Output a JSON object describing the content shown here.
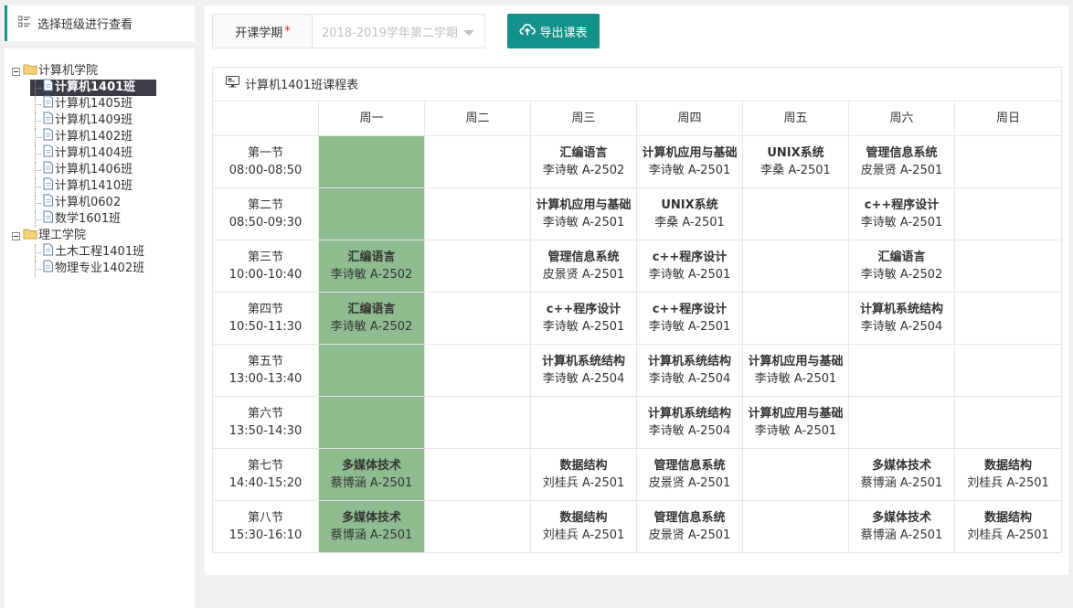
{
  "left_header": {
    "title": "选择班级进行查看"
  },
  "tree": [
    {
      "label": "计算机学院",
      "type": "folder",
      "children": [
        {
          "label": "计算机1401班",
          "selected": true
        },
        {
          "label": "计算机1405班"
        },
        {
          "label": "计算机1409班"
        },
        {
          "label": "计算机1402班"
        },
        {
          "label": "计算机1404班"
        },
        {
          "label": "计算机1406班"
        },
        {
          "label": "计算机1410班"
        },
        {
          "label": "计算机0602"
        },
        {
          "label": "数学1601班"
        }
      ]
    },
    {
      "label": "理工学院",
      "type": "folder",
      "children": [
        {
          "label": "土木工程1401班"
        },
        {
          "label": "物理专业1402班"
        }
      ]
    }
  ],
  "toolbar": {
    "semester_label": "开课学期",
    "required_mark": "*",
    "semester_value": "2018-2019学年第二学期",
    "export_label": "导出课表"
  },
  "schedule": {
    "title": "计算机1401班课程表",
    "days": [
      "周一",
      "周二",
      "周三",
      "周四",
      "周五",
      "周六",
      "周日"
    ],
    "highlight_color": "#8fbc8f",
    "highlight_day": 0,
    "periods": [
      {
        "name": "第一节",
        "time": "08:00-08:50",
        "cells": [
          null,
          null,
          {
            "course": "汇编语言",
            "teacher": "李诗敏",
            "room": "A-2502"
          },
          {
            "course": "计算机应用与基础",
            "teacher": "李诗敏",
            "room": "A-2501"
          },
          {
            "course": "UNIX系统",
            "teacher": "李桑",
            "room": "A-2501"
          },
          {
            "course": "管理信息系统",
            "teacher": "皮景贤",
            "room": "A-2501"
          },
          null
        ]
      },
      {
        "name": "第二节",
        "time": "08:50-09:30",
        "cells": [
          null,
          null,
          {
            "course": "计算机应用与基础",
            "teacher": "李诗敏",
            "room": "A-2501"
          },
          {
            "course": "UNIX系统",
            "teacher": "李桑",
            "room": "A-2501"
          },
          null,
          {
            "course": "c++程序设计",
            "teacher": "李诗敏",
            "room": "A-2501"
          },
          null
        ]
      },
      {
        "name": "第三节",
        "time": "10:00-10:40",
        "cells": [
          {
            "course": "汇编语言",
            "teacher": "李诗敏",
            "room": "A-2502"
          },
          null,
          {
            "course": "管理信息系统",
            "teacher": "皮景贤",
            "room": "A-2501"
          },
          {
            "course": "c++程序设计",
            "teacher": "李诗敏",
            "room": "A-2501"
          },
          null,
          {
            "course": "汇编语言",
            "teacher": "李诗敏",
            "room": "A-2502"
          },
          null
        ]
      },
      {
        "name": "第四节",
        "time": "10:50-11:30",
        "cells": [
          {
            "course": "汇编语言",
            "teacher": "李诗敏",
            "room": "A-2502"
          },
          null,
          {
            "course": "c++程序设计",
            "teacher": "李诗敏",
            "room": "A-2501"
          },
          {
            "course": "c++程序设计",
            "teacher": "李诗敏",
            "room": "A-2501"
          },
          null,
          {
            "course": "计算机系统结构",
            "teacher": "李诗敏",
            "room": "A-2504"
          },
          null
        ]
      },
      {
        "name": "第五节",
        "time": "13:00-13:40",
        "cells": [
          null,
          null,
          {
            "course": "计算机系统结构",
            "teacher": "李诗敏",
            "room": "A-2504"
          },
          {
            "course": "计算机系统结构",
            "teacher": "李诗敏",
            "room": "A-2504"
          },
          {
            "course": "计算机应用与基础",
            "teacher": "李诗敏",
            "room": "A-2501"
          },
          null,
          null
        ]
      },
      {
        "name": "第六节",
        "time": "13:50-14:30",
        "cells": [
          null,
          null,
          null,
          {
            "course": "计算机系统结构",
            "teacher": "李诗敏",
            "room": "A-2504"
          },
          {
            "course": "计算机应用与基础",
            "teacher": "李诗敏",
            "room": "A-2501"
          },
          null,
          null
        ]
      },
      {
        "name": "第七节",
        "time": "14:40-15:20",
        "cells": [
          {
            "course": "多媒体技术",
            "teacher": "蔡博涵",
            "room": "A-2501"
          },
          null,
          {
            "course": "数据结构",
            "teacher": "刘桂兵",
            "room": "A-2501"
          },
          {
            "course": "管理信息系统",
            "teacher": "皮景贤",
            "room": "A-2501"
          },
          null,
          {
            "course": "多媒体技术",
            "teacher": "蔡博涵",
            "room": "A-2501"
          },
          {
            "course": "数据结构",
            "teacher": "刘桂兵",
            "room": "A-2501"
          }
        ]
      },
      {
        "name": "第八节",
        "time": "15:30-16:10",
        "cells": [
          {
            "course": "多媒体技术",
            "teacher": "蔡博涵",
            "room": "A-2501"
          },
          null,
          {
            "course": "数据结构",
            "teacher": "刘桂兵",
            "room": "A-2501"
          },
          {
            "course": "管理信息系统",
            "teacher": "皮景贤",
            "room": "A-2501"
          },
          null,
          {
            "course": "多媒体技术",
            "teacher": "蔡博涵",
            "room": "A-2501"
          },
          {
            "course": "数据结构",
            "teacher": "刘桂兵",
            "room": "A-2501"
          }
        ]
      }
    ]
  }
}
